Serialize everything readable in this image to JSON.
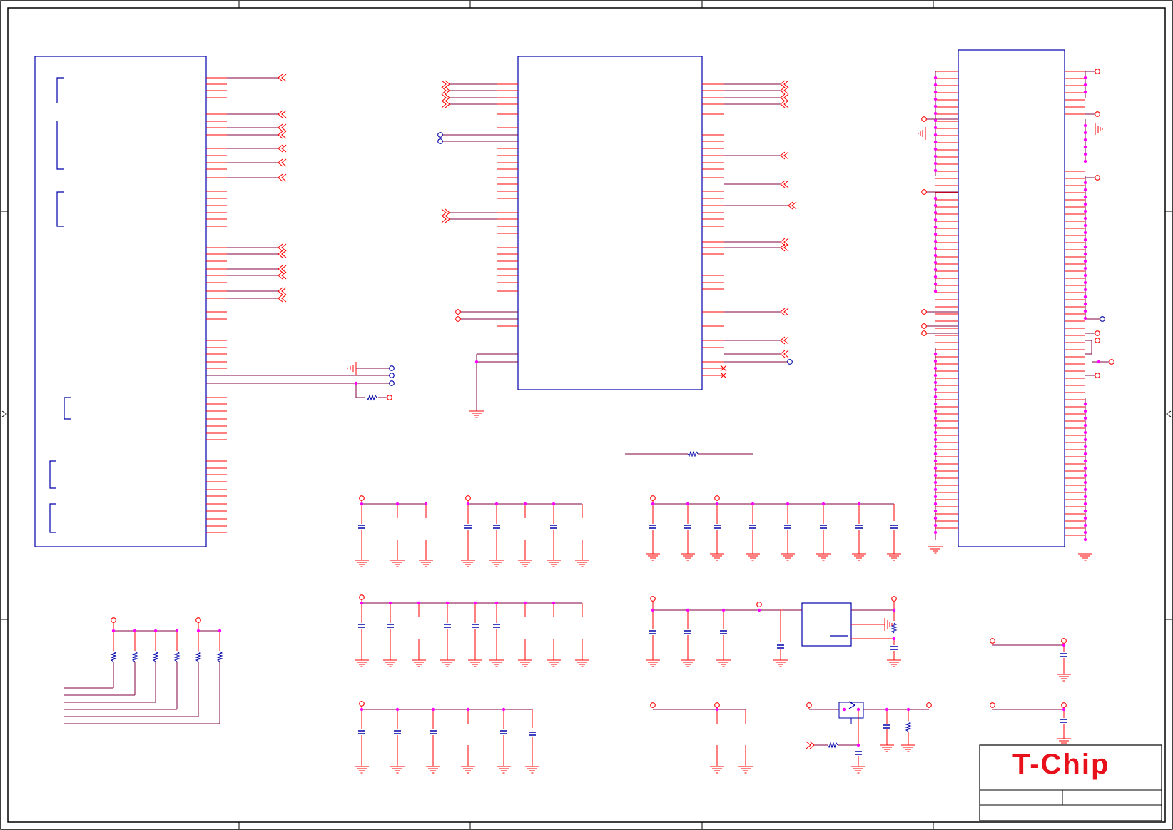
{
  "title_block": {
    "logo": "T-Chip"
  },
  "colors": {
    "border": "#000000",
    "part_outline": "#0000aa",
    "pin": "#ff0000",
    "net_wire": "#800040",
    "junction": "#ff00ff",
    "port": "#ff0000",
    "logo": "#e8101a"
  },
  "icons": {
    "port_marker": "double-chevron-left-icon",
    "net_terminal": "open-circle-icon",
    "power_symbol": "ground-icon",
    "passive": "capacitor-icon",
    "resistor": "resistor-icon"
  }
}
